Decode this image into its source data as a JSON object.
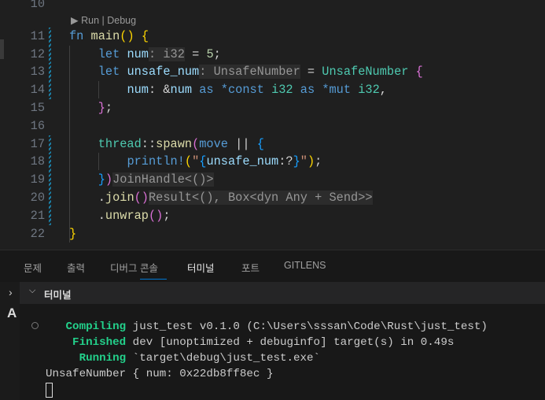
{
  "codelens": {
    "run": "Run",
    "sep": " | ",
    "debug": "Debug"
  },
  "colors": {
    "kw": "#569cd6",
    "fn": "#dcdcaa",
    "var": "#9cdcfe",
    "type": "#4ec9b0",
    "num": "#b5cea8",
    "str": "#ce9178",
    "punc": "#d4d4d4",
    "gold": "#ffd700",
    "pink": "#da70d6",
    "blue": "#179fff",
    "macro": "#569cd6"
  },
  "lines": [
    {
      "n": "10",
      "t": []
    },
    {
      "n": "11",
      "t": [
        [
          "fn ",
          "kw"
        ],
        [
          "main",
          "fn"
        ],
        [
          "()",
          "gold"
        ],
        [
          " ",
          "punc"
        ],
        [
          "{",
          "gold"
        ]
      ]
    },
    {
      "n": "12",
      "t": [
        [
          "    ",
          "punc"
        ],
        [
          "let ",
          "kw"
        ],
        [
          "num",
          "var"
        ],
        [
          ": i32",
          "hint"
        ],
        [
          " = ",
          "punc"
        ],
        [
          "5",
          "num"
        ],
        [
          ";",
          "punc"
        ]
      ]
    },
    {
      "n": "13",
      "t": [
        [
          "    ",
          "punc"
        ],
        [
          "let ",
          "kw"
        ],
        [
          "unsafe_num",
          "var"
        ],
        [
          ": UnsafeNumber",
          "hint"
        ],
        [
          " = ",
          "punc"
        ],
        [
          "UnsafeNumber",
          "type"
        ],
        [
          " ",
          "punc"
        ],
        [
          "{",
          "pink"
        ]
      ]
    },
    {
      "n": "14",
      "t": [
        [
          "        ",
          "punc"
        ],
        [
          "num",
          "var"
        ],
        [
          ": &",
          "punc"
        ],
        [
          "num",
          "var"
        ],
        [
          " as ",
          "kw"
        ],
        [
          "*const ",
          "kw"
        ],
        [
          "i32",
          "type"
        ],
        [
          " as ",
          "kw"
        ],
        [
          "*mut ",
          "kw"
        ],
        [
          "i32",
          "type"
        ],
        [
          ",",
          "punc"
        ]
      ]
    },
    {
      "n": "15",
      "t": [
        [
          "    ",
          "punc"
        ],
        [
          "}",
          "pink"
        ],
        [
          ";",
          "punc"
        ]
      ]
    },
    {
      "n": "16",
      "t": []
    },
    {
      "n": "17",
      "t": [
        [
          "    ",
          "punc"
        ],
        [
          "thread",
          "type"
        ],
        [
          "::",
          "punc"
        ],
        [
          "spawn",
          "fn"
        ],
        [
          "(",
          "pink"
        ],
        [
          "move ",
          "kw"
        ],
        [
          "|| ",
          "punc"
        ],
        [
          "{",
          "blue"
        ]
      ]
    },
    {
      "n": "18",
      "t": [
        [
          "        ",
          "punc"
        ],
        [
          "println!",
          "macro"
        ],
        [
          "(",
          "gold"
        ],
        [
          "\"",
          "str"
        ],
        [
          "{",
          "blue"
        ],
        [
          "unsafe_num",
          "var"
        ],
        [
          ":?",
          "punc"
        ],
        [
          "}",
          "blue"
        ],
        [
          "\"",
          "str"
        ],
        [
          ")",
          "gold"
        ],
        [
          ";",
          "punc"
        ]
      ]
    },
    {
      "n": "19",
      "t": [
        [
          "    ",
          "punc"
        ],
        [
          "}",
          "blue"
        ],
        [
          ")",
          "pink"
        ],
        [
          "JoinHandle<()>",
          "hint"
        ]
      ]
    },
    {
      "n": "20",
      "t": [
        [
          "    .",
          "punc"
        ],
        [
          "join",
          "fn"
        ],
        [
          "()",
          "pink"
        ],
        [
          "Result<(), Box<dyn Any + Send>>",
          "hint"
        ]
      ]
    },
    {
      "n": "21",
      "t": [
        [
          "    .",
          "punc"
        ],
        [
          "unwrap",
          "fn"
        ],
        [
          "()",
          "pink"
        ],
        [
          ";",
          "punc"
        ]
      ]
    },
    {
      "n": "22",
      "t": [
        [
          "}",
          "gold"
        ]
      ]
    }
  ],
  "panel": {
    "tabs": [
      "문제",
      "출력",
      "디버그 콘솔",
      "터미널",
      "포트",
      "GITLENS"
    ],
    "active": 3,
    "terminal_title": "터미널"
  },
  "terminal": [
    {
      "label": "   Compiling",
      "rest": " just_test v0.1.0 (C:\\Users\\sssan\\Code\\Rust\\just_test)"
    },
    {
      "label": "    Finished",
      "rest": " dev [unoptimized + debuginfo] target(s) in 0.49s"
    },
    {
      "label": "     Running",
      "rest": " `target\\debug\\just_test.exe`"
    },
    {
      "label": "",
      "rest": "UnsafeNumber { num: 0x22db8ff8ec }"
    }
  ]
}
